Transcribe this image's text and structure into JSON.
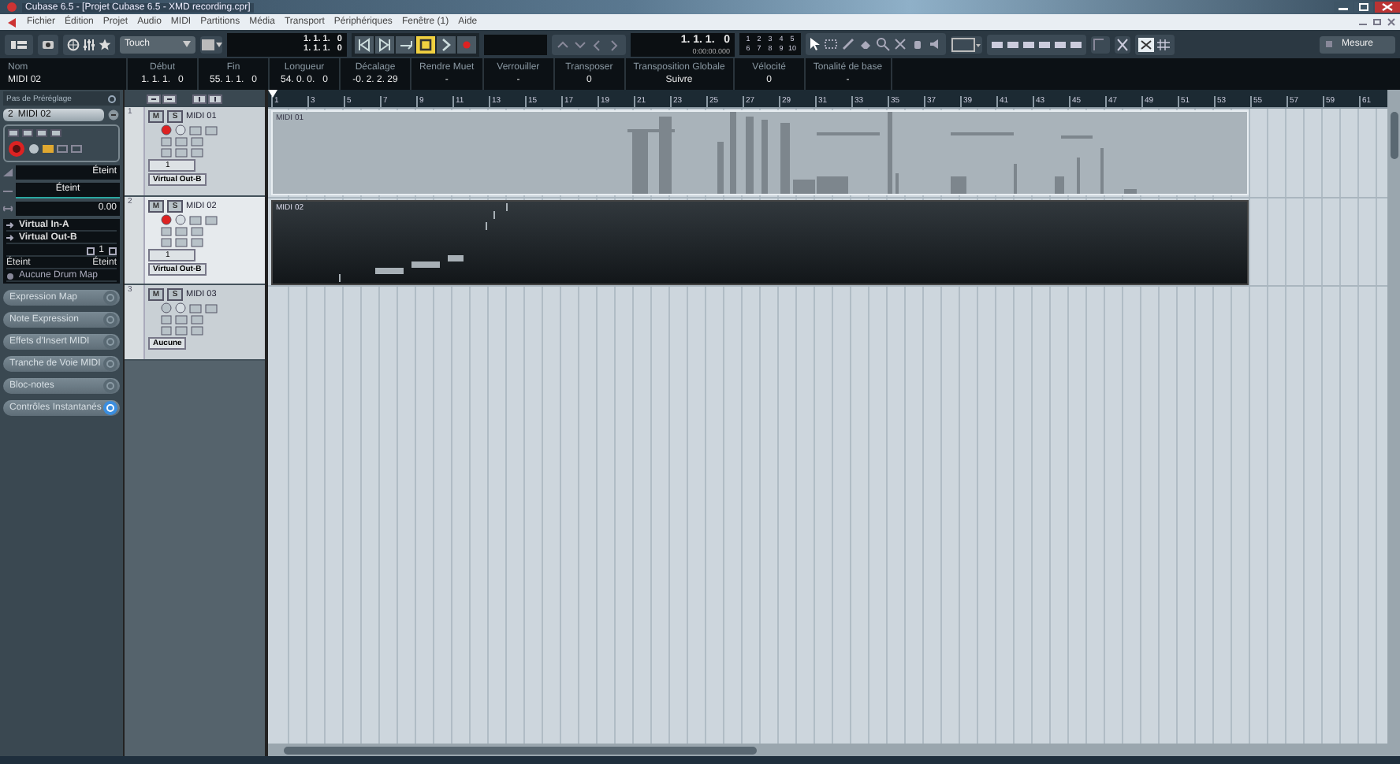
{
  "window": {
    "title": "Cubase 6.5 - [Projet Cubase 6.5 - XMD recording.cpr]"
  },
  "menu": [
    "Fichier",
    "Édition",
    "Projet",
    "Audio",
    "MIDI",
    "Partitions",
    "Média",
    "Transport",
    "Périphériques",
    "Fenêtre (1)",
    "Aide"
  ],
  "toolbar": {
    "automation_mode": "Touch",
    "locators": [
      "1. 1. 1.   0",
      "1. 1. 1.   0"
    ],
    "transport": [
      {
        "kind": "to-start",
        "on": false
      },
      {
        "kind": "to-end",
        "on": false
      },
      {
        "kind": "cycle",
        "on": false
      },
      {
        "kind": "stop",
        "on": true
      },
      {
        "kind": "play",
        "on": false
      },
      {
        "kind": "record",
        "on": false
      }
    ],
    "position": "1. 1. 1.   0",
    "position_time": "0:00:00.000",
    "markers": [
      "1",
      "2",
      "3",
      "4",
      "5",
      "6",
      "7",
      "8",
      "9",
      "10"
    ],
    "grid": "Mesure"
  },
  "info_line": [
    {
      "label": "Nom",
      "value": "MIDI 02"
    },
    {
      "label": "Début",
      "value": "1. 1. 1.   0"
    },
    {
      "label": "Fin",
      "value": "55. 1. 1.   0"
    },
    {
      "label": "Longueur",
      "value": "54. 0. 0.   0"
    },
    {
      "label": "Décalage",
      "value": "-0. 2. 2. 29"
    },
    {
      "label": "Rendre Muet",
      "value": "-"
    },
    {
      "label": "Verrouiller",
      "value": "-"
    },
    {
      "label": "Transposer",
      "value": "0"
    },
    {
      "label": "Transposition Globale",
      "value": "Suivre"
    },
    {
      "label": "Vélocité",
      "value": "0"
    },
    {
      "label": "Tonalité de base",
      "value": "-"
    }
  ],
  "inspector": {
    "preset": "Pas de Préréglage",
    "track_number": "2",
    "track_name": "MIDI 02",
    "record": true,
    "volume": "Éteint",
    "pan": "Éteint",
    "delay": "0.00",
    "input": "Virtual In-A",
    "output": "Virtual Out-B",
    "channel": "1",
    "bank": "Éteint",
    "program": "Éteint",
    "drum_map": "Aucune Drum Map",
    "sections": [
      {
        "label": "Expression Map",
        "on": false
      },
      {
        "label": "Note Expression",
        "on": false
      },
      {
        "label": "Effets d'Insert MIDI",
        "on": false
      },
      {
        "label": "Tranche de Voie MIDI",
        "on": false
      },
      {
        "label": "Bloc-notes",
        "on": false
      },
      {
        "label": "Contrôles Instantanés",
        "on": true
      }
    ]
  },
  "tracks": [
    {
      "number": "1",
      "name": "MIDI 01",
      "mute": "M",
      "solo": "S",
      "selected": false,
      "record": true,
      "channel": "1",
      "output": "Virtual Out-B"
    },
    {
      "number": "2",
      "name": "MIDI 02",
      "mute": "M",
      "solo": "S",
      "selected": true,
      "record": true,
      "channel": "1",
      "output": "Virtual Out-B"
    },
    {
      "number": "3",
      "name": "MIDI 03",
      "mute": "M",
      "solo": "S",
      "selected": false,
      "record": false,
      "output": "Aucune"
    }
  ],
  "ruler": {
    "bars": [
      "1",
      "3",
      "5",
      "7",
      "9",
      "11",
      "13",
      "15",
      "17",
      "19",
      "21",
      "23",
      "25",
      "27",
      "29",
      "31",
      "33",
      "35",
      "37",
      "39",
      "41",
      "43",
      "45",
      "47",
      "49",
      "51",
      "53",
      "55",
      "57",
      "59",
      "61"
    ]
  },
  "parts": [
    {
      "name": "MIDI 01",
      "selected": false
    },
    {
      "name": "MIDI 02",
      "selected": true
    }
  ]
}
